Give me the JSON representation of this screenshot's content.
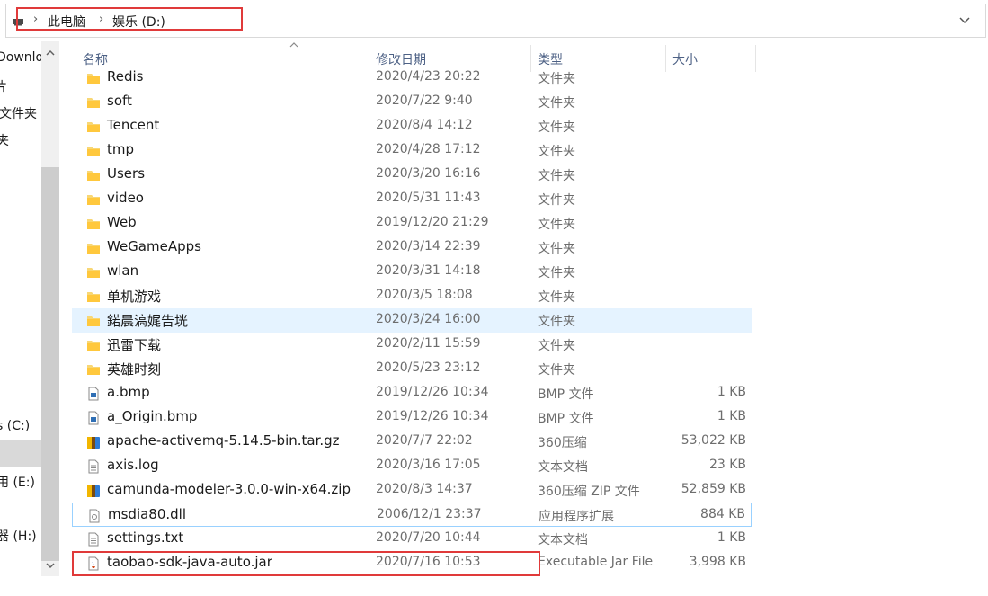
{
  "address_bar": {
    "crumbs": [
      "此电脑",
      "娱乐 (D:)"
    ]
  },
  "nav": {
    "items": [
      {
        "label": "Downlo"
      },
      {
        "label": "片"
      },
      {
        "label": "文件夹"
      },
      {
        "label": "夹"
      },
      {
        "label": "s (C:)"
      },
      {
        "label": ""
      },
      {
        "label": "用 (E:)"
      },
      {
        "label": "器 (H:)"
      }
    ]
  },
  "columns": {
    "name": "名称",
    "date": "修改日期",
    "type": "类型",
    "size": "大小"
  },
  "files": [
    {
      "name": "Redis",
      "date": "2020/4/23 20:22",
      "type": "文件夹",
      "size": "",
      "icon": "folder-icon"
    },
    {
      "name": "soft",
      "date": "2020/7/22 9:40",
      "type": "文件夹",
      "size": "",
      "icon": "folder-icon"
    },
    {
      "name": "Tencent",
      "date": "2020/8/4 14:12",
      "type": "文件夹",
      "size": "",
      "icon": "folder-icon"
    },
    {
      "name": "tmp",
      "date": "2020/4/28 17:12",
      "type": "文件夹",
      "size": "",
      "icon": "folder-icon"
    },
    {
      "name": "Users",
      "date": "2020/3/20 16:16",
      "type": "文件夹",
      "size": "",
      "icon": "folder-icon"
    },
    {
      "name": "video",
      "date": "2020/5/31 11:43",
      "type": "文件夹",
      "size": "",
      "icon": "folder-icon"
    },
    {
      "name": "Web",
      "date": "2019/12/20 21:29",
      "type": "文件夹",
      "size": "",
      "icon": "folder-icon"
    },
    {
      "name": "WeGameApps",
      "date": "2020/3/14 22:39",
      "type": "文件夹",
      "size": "",
      "icon": "folder-icon"
    },
    {
      "name": "wlan",
      "date": "2020/3/31 14:18",
      "type": "文件夹",
      "size": "",
      "icon": "folder-icon"
    },
    {
      "name": "单机游戏",
      "date": "2020/3/5 18:08",
      "type": "文件夹",
      "size": "",
      "icon": "folder-icon"
    },
    {
      "name": "鍩晨滈娓告垙",
      "date": "2020/3/24 16:00",
      "type": "文件夹",
      "size": "",
      "icon": "folder-icon"
    },
    {
      "name": "迅雷下载",
      "date": "2020/2/11 15:59",
      "type": "文件夹",
      "size": "",
      "icon": "folder-icon"
    },
    {
      "name": "英雄时刻",
      "date": "2020/5/23 23:12",
      "type": "文件夹",
      "size": "",
      "icon": "folder-icon"
    },
    {
      "name": "a.bmp",
      "date": "2019/12/26 10:34",
      "type": "BMP 文件",
      "size": "1 KB",
      "icon": "image-file-icon"
    },
    {
      "name": "a_Origin.bmp",
      "date": "2019/12/26 10:34",
      "type": "BMP 文件",
      "size": "1 KB",
      "icon": "image-file-icon"
    },
    {
      "name": "apache-activemq-5.14.5-bin.tar.gz",
      "date": "2020/7/7 22:02",
      "type": "360压缩",
      "size": "53,022 KB",
      "icon": "archive-icon"
    },
    {
      "name": "axis.log",
      "date": "2020/3/16 17:05",
      "type": "文本文档",
      "size": "23 KB",
      "icon": "text-file-icon"
    },
    {
      "name": "camunda-modeler-3.0.0-win-x64.zip",
      "date": "2020/8/3 14:37",
      "type": "360压缩 ZIP 文件",
      "size": "52,859 KB",
      "icon": "archive-icon"
    },
    {
      "name": "msdia80.dll",
      "date": "2006/12/1 23:37",
      "type": "应用程序扩展",
      "size": "884 KB",
      "icon": "dll-file-icon"
    },
    {
      "name": "settings.txt",
      "date": "2020/7/20 10:44",
      "type": "文本文档",
      "size": "1 KB",
      "icon": "text-file-icon"
    },
    {
      "name": "taobao-sdk-java-auto.jar",
      "date": "2020/7/16 10:53",
      "type": "Executable Jar File",
      "size": "3,998 KB",
      "icon": "jar-file-icon"
    }
  ],
  "hover_row_index": 10,
  "selected_row_index": 18,
  "highlight_color": "#e03a3a"
}
